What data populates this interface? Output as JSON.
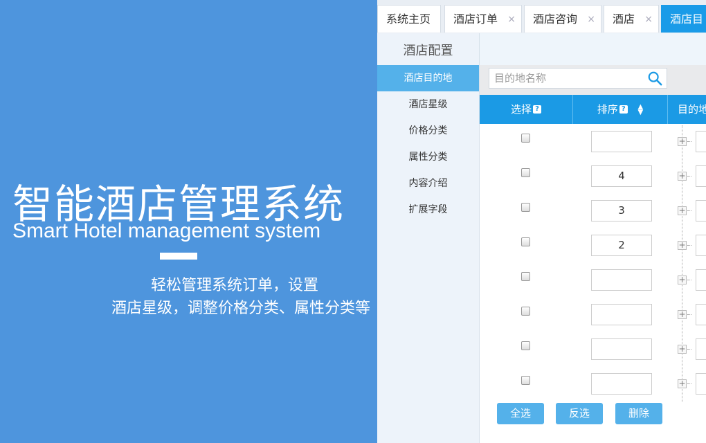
{
  "hero": {
    "title": "智能酒店管理系统",
    "subtitle": "Smart Hotel management system",
    "desc_line1": "轻松管理系统订单，设置",
    "desc_line2": "酒店星级，调整价格分类、属性分类等"
  },
  "tabs": [
    {
      "label": "系统主页",
      "closable": false
    },
    {
      "label": "酒店订单",
      "closable": true
    },
    {
      "label": "酒店咨询",
      "closable": true
    },
    {
      "label": "酒店",
      "closable": true
    },
    {
      "label": "酒店目",
      "closable": false,
      "active": true
    }
  ],
  "close_glyph": "×",
  "sidebar": {
    "title": "酒店配置",
    "items": [
      {
        "label": "酒店目的地",
        "active": true
      },
      {
        "label": "酒店星级"
      },
      {
        "label": "价格分类"
      },
      {
        "label": "属性分类"
      },
      {
        "label": "内容介绍"
      },
      {
        "label": "扩展字段"
      }
    ]
  },
  "search": {
    "placeholder": "目的地名称",
    "icon": "search-icon"
  },
  "table": {
    "col_select": "选择",
    "col_order": "排序",
    "col_dest": "目的地",
    "help_glyph": "?",
    "rows": [
      {
        "order": ""
      },
      {
        "order": "4"
      },
      {
        "order": "3"
      },
      {
        "order": "2"
      },
      {
        "order": ""
      },
      {
        "order": ""
      },
      {
        "order": ""
      },
      {
        "order": ""
      }
    ]
  },
  "actions": {
    "select_all": "全选",
    "invert": "反选",
    "delete": "删除"
  },
  "colors": {
    "hero_bg": "#4e95dd",
    "accent": "#1b9ae5",
    "button": "#54b1ea"
  }
}
